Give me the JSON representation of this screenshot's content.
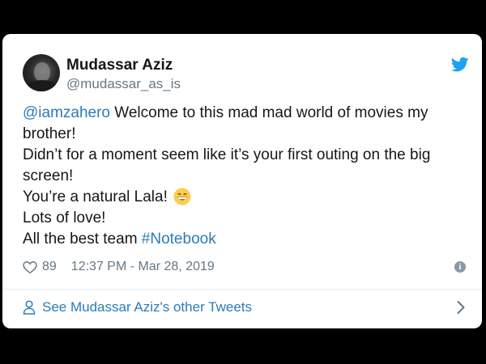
{
  "author": {
    "display_name": "Mudassar Aziz",
    "handle": "@mudassar_as_is",
    "avatar_icon": "profile-photo"
  },
  "brand_icon": "twitter-bird-icon",
  "tweet": {
    "mention": "@iamzahero",
    "line1_rest": " Welcome to this mad mad world of movies my brother!",
    "line2": "Didn’t for a moment seem like it’s your first outing on the big screen!",
    "line3": "You’re a natural Lala!",
    "line3_emoji": "grinning-face-emoji",
    "line4": "Lots of love!",
    "line5_text": "All the best team ",
    "hashtag": "#Notebook"
  },
  "meta": {
    "likes": "89",
    "timestamp": "12:37 PM - Mar 28, 2019",
    "info_icon": "info-icon"
  },
  "footer": {
    "link_text": "See Mudassar Aziz's other Tweets",
    "link_icon": "person-icon",
    "chevron_icon": "chevron-right-icon"
  },
  "colors": {
    "background": "#000000",
    "card": "#ffffff",
    "text": "#14171a",
    "secondary": "#657786",
    "link": "#2b7bb9",
    "twitter_blue": "#1da1f2"
  }
}
